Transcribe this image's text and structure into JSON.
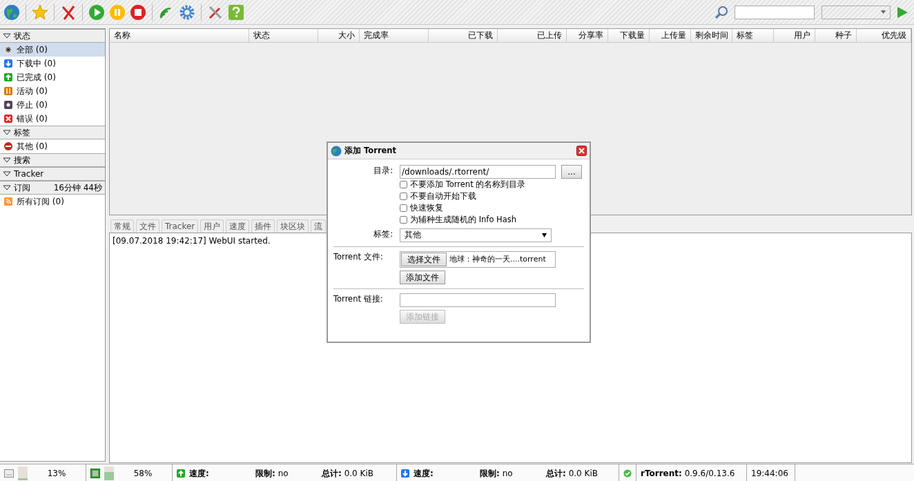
{
  "sidebar": {
    "sections": [
      {
        "title": "状态",
        "items": [
          {
            "label": "全部 (0)",
            "selected": true
          },
          {
            "label": "下载中 (0)",
            "selected": false
          },
          {
            "label": "已完成 (0)",
            "selected": false
          },
          {
            "label": "活动 (0)",
            "selected": false
          },
          {
            "label": "停止 (0)",
            "selected": false
          },
          {
            "label": "错误 (0)",
            "selected": false
          }
        ]
      },
      {
        "title": "标签",
        "items": [
          {
            "label": "其他 (0)",
            "selected": false
          }
        ]
      },
      {
        "title": "搜索"
      },
      {
        "title": "Tracker"
      },
      {
        "title": "订阅",
        "extra": "16分钟 44秒",
        "items": [
          {
            "label": "所有订阅 (0)",
            "selected": false
          }
        ]
      }
    ]
  },
  "table": {
    "columns": [
      "名称",
      "状态",
      "大小",
      "完成率",
      "已下载",
      "已上传",
      "分享率",
      "下载量",
      "上传量",
      "剩余时间",
      "标签",
      "用户",
      "种子",
      "优先级"
    ]
  },
  "tabs": [
    {
      "label": "常规",
      "selected": false
    },
    {
      "label": "文件",
      "selected": false
    },
    {
      "label": "Tracker",
      "selected": false
    },
    {
      "label": "用户",
      "selected": false
    },
    {
      "label": "速度",
      "selected": false
    },
    {
      "label": "插件",
      "selected": false
    },
    {
      "label": "块区块",
      "selected": false
    },
    {
      "label": "流",
      "selected": false
    }
  ],
  "log": [
    "[09.07.2018 19:42:17] WebUI started."
  ],
  "dialog": {
    "title": "添加 Torrent",
    "directory_label": "目录:",
    "directory_value": "/downloads/.rtorrent/",
    "browse_button": "...",
    "options": [
      {
        "label": "不要添加 Torrent 的名称到目录",
        "checked": false
      },
      {
        "label": "不要自动开始下载",
        "checked": false
      },
      {
        "label": "快速恢复",
        "checked": false
      },
      {
        "label": "为辅种生成随机的 Info Hash",
        "checked": false
      }
    ],
    "label_label": "标签:",
    "label_value": "其他",
    "file_label": "Torrent 文件:",
    "choose_button": "选择文件",
    "chosen_file": "地球：神奇的一天....torrent",
    "add_file_button": "添加文件",
    "link_label": "Torrent 链接:",
    "add_link_button": "添加链接",
    "add_link_disabled": true
  },
  "status_bar": {
    "disk": {
      "level": 0.13,
      "reading": "13%"
    },
    "memory": {
      "level": 0.58,
      "reading": "58%"
    },
    "upload": {
      "speed_label": "速度:",
      "limit_label": "限制:",
      "limit": "no",
      "total_label": "总计:",
      "total": "0.0 KiB"
    },
    "download": {
      "speed_label": "速度:",
      "limit_label": "限制:",
      "limit": "no",
      "total_label": "总计:",
      "total": "0.0 KiB"
    },
    "client_label": "rTorrent:",
    "client_version": "0.9.6/0.13.6",
    "time": "19:44:06"
  }
}
